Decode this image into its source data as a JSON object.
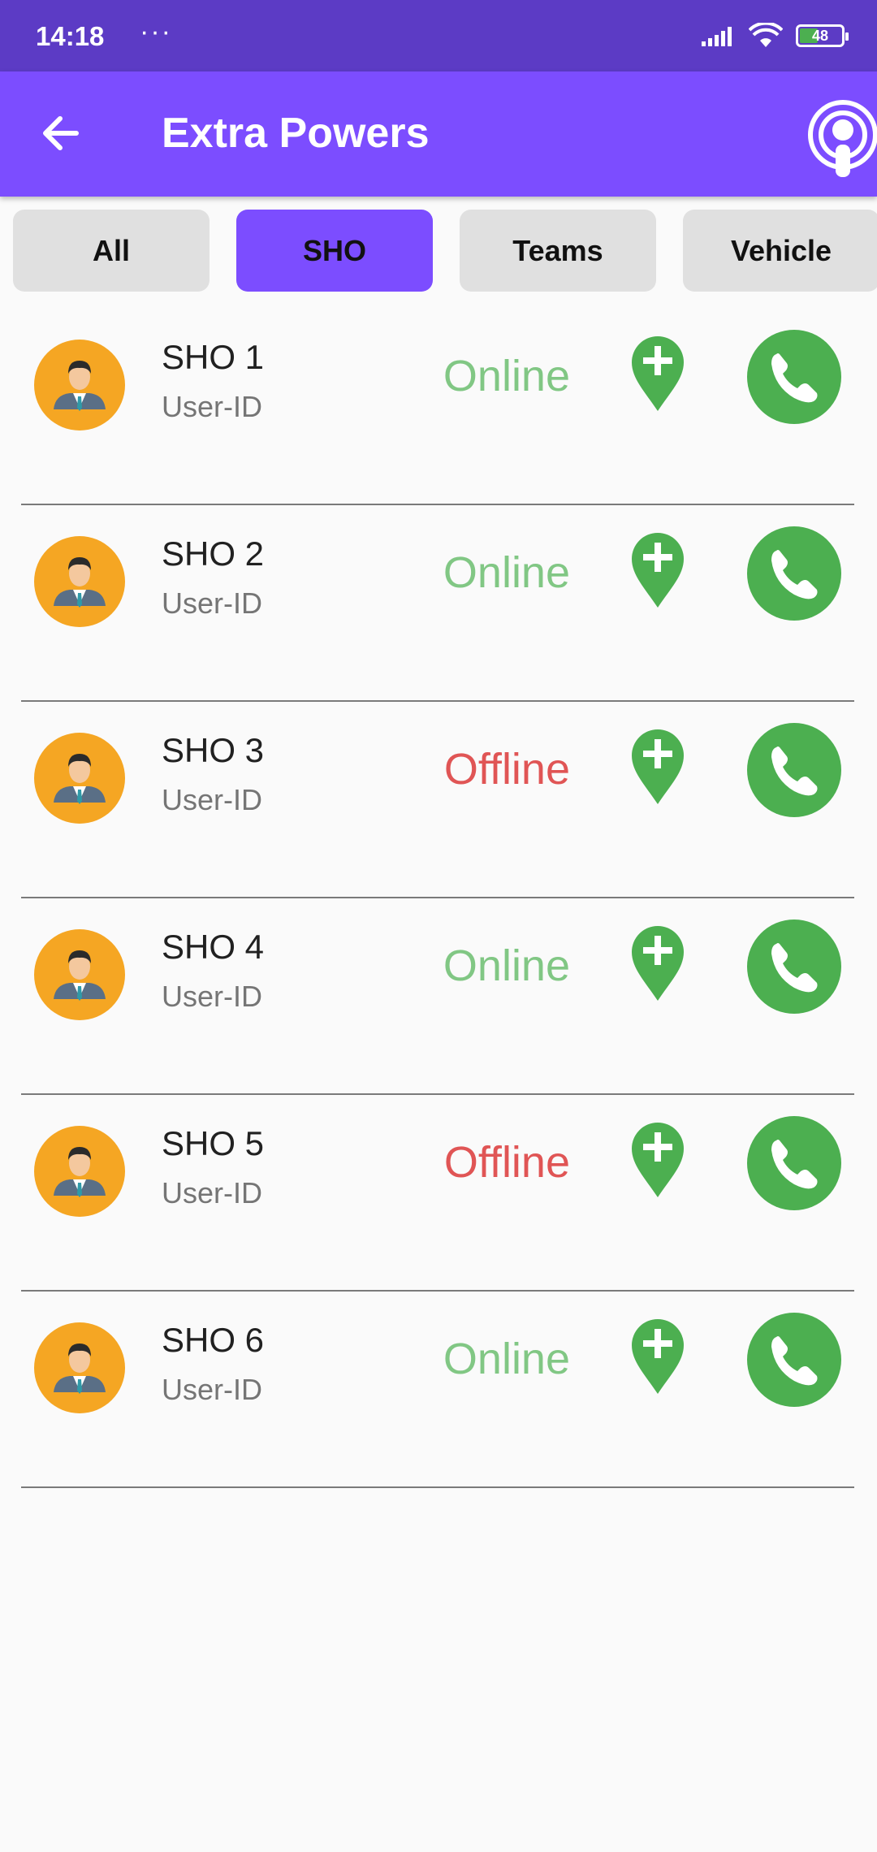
{
  "status_bar": {
    "time": "14:18",
    "dots": "···",
    "battery": "48"
  },
  "app_bar": {
    "title": "Extra Powers"
  },
  "tabs": [
    {
      "label": "All",
      "active": false
    },
    {
      "label": "SHO",
      "active": true
    },
    {
      "label": "Teams",
      "active": false
    },
    {
      "label": "Vehicle",
      "active": false
    }
  ],
  "contacts": [
    {
      "name": "SHO 1",
      "subtitle": "User-ID",
      "status": "Online"
    },
    {
      "name": "SHO 2",
      "subtitle": "User-ID",
      "status": "Online"
    },
    {
      "name": "SHO 3",
      "subtitle": "User-ID",
      "status": "Offline"
    },
    {
      "name": "SHO 4",
      "subtitle": "User-ID",
      "status": "Online"
    },
    {
      "name": "SHO 5",
      "subtitle": "User-ID",
      "status": "Offline"
    },
    {
      "name": "SHO 6",
      "subtitle": "User-ID",
      "status": "Online"
    }
  ],
  "colors": {
    "status_bar": "#5c3bc5",
    "app_bar": "#7c4dff",
    "online": "#81c784",
    "offline": "#e05555",
    "action_green": "#4caf50",
    "avatar_bg": "#f5a623"
  },
  "icons": {
    "back": "arrow-left-icon",
    "header_action": "podcast-icon",
    "row_location": "add-location-icon",
    "row_call": "phone-icon",
    "row_avatar": "businessman-avatar-icon"
  }
}
